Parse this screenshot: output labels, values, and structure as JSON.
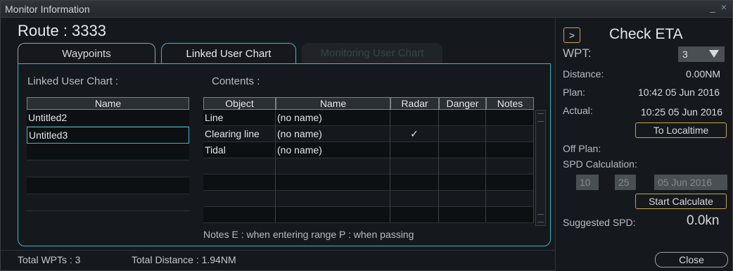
{
  "window": {
    "title": "Monitor Information",
    "controls": "_ ×"
  },
  "route_title": "Route :  3333",
  "tabs": [
    {
      "label": "Waypoints"
    },
    {
      "label": "Linked User Chart"
    },
    {
      "label": "Monitoring User Chart"
    }
  ],
  "linked": {
    "label": "Linked User Chart :",
    "header": "Name",
    "items": [
      "Untitled2",
      "Untitled3",
      "",
      "",
      "",
      ""
    ]
  },
  "contents": {
    "label": "Contents :",
    "headers": [
      "Object",
      "Name",
      "Radar",
      "Danger",
      "Notes"
    ],
    "rows": [
      [
        "Line",
        "(no name)",
        "",
        "",
        ""
      ],
      [
        "Clearing line",
        "(no name)",
        "✓",
        "",
        ""
      ],
      [
        "Tidal",
        "(no name)",
        "",
        "",
        ""
      ],
      [
        "",
        "",
        "",
        "",
        ""
      ],
      [
        "",
        "",
        "",
        "",
        ""
      ],
      [
        "",
        "",
        "",
        "",
        ""
      ],
      [
        "",
        "",
        "",
        "",
        ""
      ]
    ],
    "notes": "Notes  E : when entering range   P : when passing"
  },
  "status": {
    "total_wpts": "Total WPTs : 3",
    "total_distance": "Total Distance : 1.94NM"
  },
  "eta": {
    "expand": ">",
    "title": "Check ETA",
    "wpt_label": "WPT:",
    "wpt_value": "3",
    "distance_label": "Distance:",
    "distance_value": "0.00NM",
    "plan_label": "Plan:",
    "plan_value": "10:42 05 Jun 2016",
    "actual_label": "Actual:",
    "actual_value": "10:25 05 Jun 2016",
    "to_localtime": "To Localtime",
    "off_plan_label": "Off Plan:",
    "spd_calc_label": "SPD Calculation:",
    "calc_hour": "10",
    "calc_min": "25",
    "calc_date": "05 Jun 2016",
    "start_calculate": "Start Calculate",
    "suggested_label": "Suggested SPD:",
    "suggested_value": "0.0kn",
    "close": "Close"
  }
}
